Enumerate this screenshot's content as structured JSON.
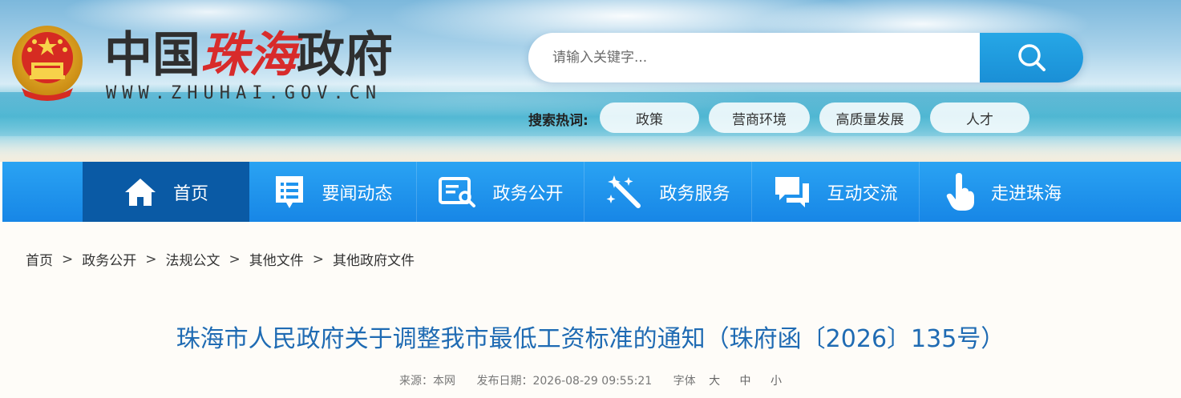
{
  "header": {
    "site_name_prefix": "中国",
    "site_name_city": "珠海",
    "site_name_suffix": "政府",
    "site_domain": "WWW.ZHUHAI.GOV.CN",
    "emblem_icon": "national-emblem-icon"
  },
  "search": {
    "placeholder": "请输入关键字...",
    "button_icon": "search-icon",
    "hot_label": "搜索热词:",
    "hot_tags": [
      "政策",
      "营商环境",
      "高质量发展",
      "人才"
    ]
  },
  "nav": {
    "items": [
      {
        "label": "首页",
        "icon": "home-icon",
        "active": true
      },
      {
        "label": "要闻动态",
        "icon": "news-list-icon",
        "active": false
      },
      {
        "label": "政务公开",
        "icon": "document-icon",
        "active": false
      },
      {
        "label": "政务服务",
        "icon": "magic-wand-icon",
        "active": false
      },
      {
        "label": "互动交流",
        "icon": "chat-icon",
        "active": false
      },
      {
        "label": "走进珠海",
        "icon": "pointer-hand-icon",
        "active": false
      }
    ]
  },
  "breadcrumb": {
    "items": [
      "首页",
      "政务公开",
      "法规公文",
      "其他文件",
      "其他政府文件"
    ],
    "separator": ">"
  },
  "article": {
    "title": "珠海市人民政府关于调整我市最低工资标准的通知（珠府函〔2026〕135号）",
    "source_label": "来源：",
    "source_value": "本网",
    "date_label": "发布日期：",
    "date_value": "2026-08-29 09:55:21",
    "font_label": "字体",
    "font_large": "大",
    "font_medium": "中",
    "font_small": "小"
  },
  "colors": {
    "nav_bg": "#1f94ee",
    "nav_active": "#0a5aa5",
    "title_color": "#1f6bb3",
    "search_button": "#1f9ae0",
    "city_red": "#d82b2b"
  }
}
